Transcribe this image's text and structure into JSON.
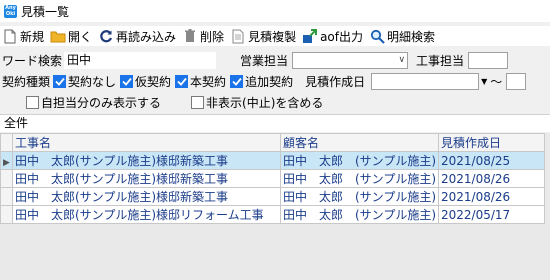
{
  "window": {
    "app_icon_text": "Any Oki",
    "title": "見積一覧"
  },
  "toolbar": {
    "new_label": "新規",
    "open_label": "開く",
    "reload_label": "再読み込み",
    "delete_label": "削除",
    "duplicate_label": "見積複製",
    "aof_label": "aof出力",
    "detail_search_label": "明細検索"
  },
  "filters": {
    "word_search_label": "ワード検索",
    "word_search_value": "田中",
    "sales_rep_label": "営業担当",
    "sales_rep_value": "",
    "construction_rep_label": "工事担当",
    "construction_rep_value": "",
    "contract_type_label": "契約種類",
    "contract_options": [
      {
        "label": "契約なし",
        "checked": true
      },
      {
        "label": "仮契約",
        "checked": true
      },
      {
        "label": "本契約",
        "checked": true
      },
      {
        "label": "追加契約",
        "checked": true
      }
    ],
    "estimate_date_label": "見積作成日",
    "date_from_value": "",
    "date_range_separator": "～",
    "only_mine_label": "自担当分のみ表示する",
    "only_mine_checked": false,
    "include_hidden_label": "非表示(中止)を含める",
    "include_hidden_checked": false
  },
  "group_tab_label": "全件",
  "table": {
    "headers": [
      "工事名",
      "顧客名",
      "見積作成日"
    ],
    "rows": [
      [
        "田中　太郎(サンプル施主)様邸新築工事",
        "田中　太郎　(サンプル施主)",
        "2021/08/25"
      ],
      [
        "田中　太郎(サンプル施主)様邸新築工事",
        "田中　太郎　(サンプル施主)",
        "2021/08/26"
      ],
      [
        "田中　太郎(サンプル施主)様邸新築工事",
        "田中　太郎　(サンプル施主)",
        "2021/08/26"
      ],
      [
        "田中　太郎(サンプル施主)様邸リフォーム工事",
        "田中　太郎　(サンプル施主)",
        "2022/05/17"
      ]
    ],
    "selected_row": 0
  },
  "colors": {
    "accent": "#1a73e8",
    "selected_row": "#c9e6f7",
    "grid_text": "#1a3c8a"
  }
}
